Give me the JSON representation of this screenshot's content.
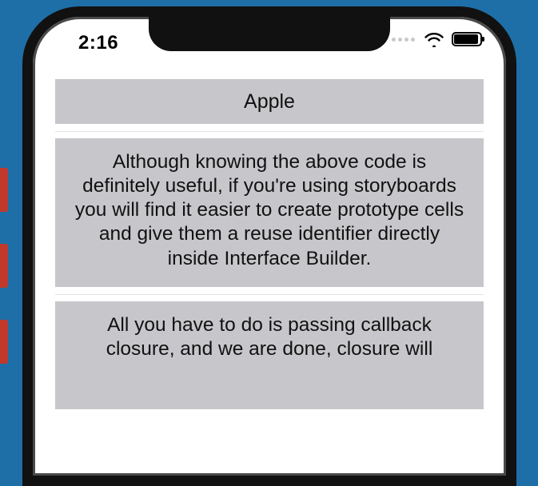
{
  "statusbar": {
    "time": "2:16"
  },
  "cells": {
    "title": "Apple",
    "paragraph1": "Although knowing the above code is definitely useful, if you're using storyboards you will find it easier to create prototype cells and give them a reuse identifier directly inside Interface Builder.",
    "paragraph2": "All you have to do is passing callback closure, and we are done, closure will"
  }
}
